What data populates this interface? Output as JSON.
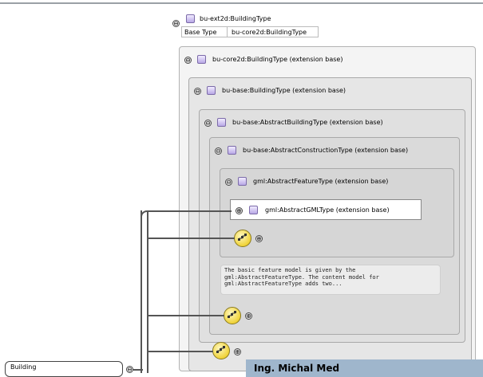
{
  "top_element": {
    "name": "bu-ext2d:BuildingType",
    "base_type_label": "Base Type",
    "base_type_value": "bu-core2d:BuildingType"
  },
  "nested_types": [
    {
      "label": "bu-core2d:BuildingType (extension base)"
    },
    {
      "label": "bu-base:BuildingType (extension base)"
    },
    {
      "label": "bu-base:AbstractBuildingType (extension base)"
    },
    {
      "label": "bu-base:AbstractConstructionType (extension base)"
    },
    {
      "label": "gml:AbstractFeatureType (extension base)"
    },
    {
      "label": "gml:AbstractGMLType (extension base)"
    }
  ],
  "annotation": {
    "lines": [
      "The basic feature model is given by the",
      "gml:AbstractFeatureType. The content model for",
      "gml:AbstractFeatureType adds two..."
    ]
  },
  "building_node": {
    "label": "Building"
  },
  "author_banner": {
    "text": "Ing. Michal Med"
  },
  "icons": {
    "collapse": "⊖",
    "expand": "⊕",
    "sequence": "sequence-icon"
  }
}
